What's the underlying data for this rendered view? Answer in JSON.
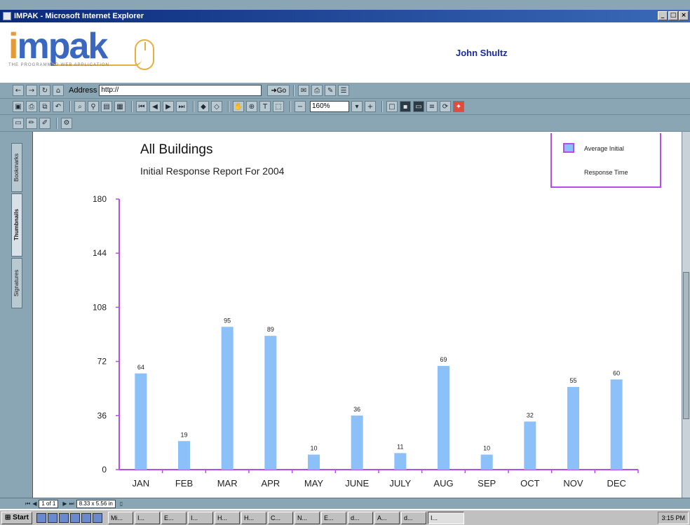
{
  "window": {
    "title": "IMPAK - Microsoft Internet Explorer",
    "buttons": [
      "_",
      "□",
      "×"
    ]
  },
  "header": {
    "logo_text": "mpak",
    "logo_tagline": "THE PROGRAMMED WEB APPLICATION",
    "user_name": "John Shultz"
  },
  "address_bar": {
    "label": "Address",
    "value": "http://",
    "go_label": "Go"
  },
  "viewer": {
    "zoom": "160%",
    "page": "1 of 1",
    "page_size": "8.33 x 5.56 in"
  },
  "side_tabs": [
    "Bookmarks",
    "Thumbnails",
    "Signatures"
  ],
  "chart_data": {
    "type": "bar",
    "title": "All Buildings",
    "subtitle": "Initial Response Report For 2004",
    "categories": [
      "JAN",
      "FEB",
      "MAR",
      "APR",
      "MAY",
      "JUNE",
      "JULY",
      "AUG",
      "SEP",
      "OCT",
      "NOV",
      "DEC"
    ],
    "series": [
      {
        "name": "Average Initial Response Time",
        "values": [
          64,
          19,
          95,
          89,
          10,
          36,
          11,
          69,
          10,
          32,
          55,
          60
        ]
      }
    ],
    "data_labels": [
      64,
      19,
      95,
      89,
      10,
      36,
      11,
      69,
      10,
      32,
      55,
      60
    ],
    "yticks": [
      0,
      36,
      72,
      108,
      144,
      180
    ],
    "ylim": [
      0,
      180
    ],
    "legend": {
      "line1": "Average Initial",
      "line2": "Response Time",
      "position": "top-right"
    },
    "bar_color": "#8cc0f8",
    "axis_color": "#b44ee8",
    "grid": false
  },
  "taskbar": {
    "start_label": "Start",
    "items": [
      "Mi...",
      "I...",
      "E...",
      "I...",
      "H...",
      "H...",
      "C...",
      "N...",
      "E...",
      "d...",
      "A...",
      "d...",
      "I..."
    ],
    "clock": "3:15 PM"
  }
}
